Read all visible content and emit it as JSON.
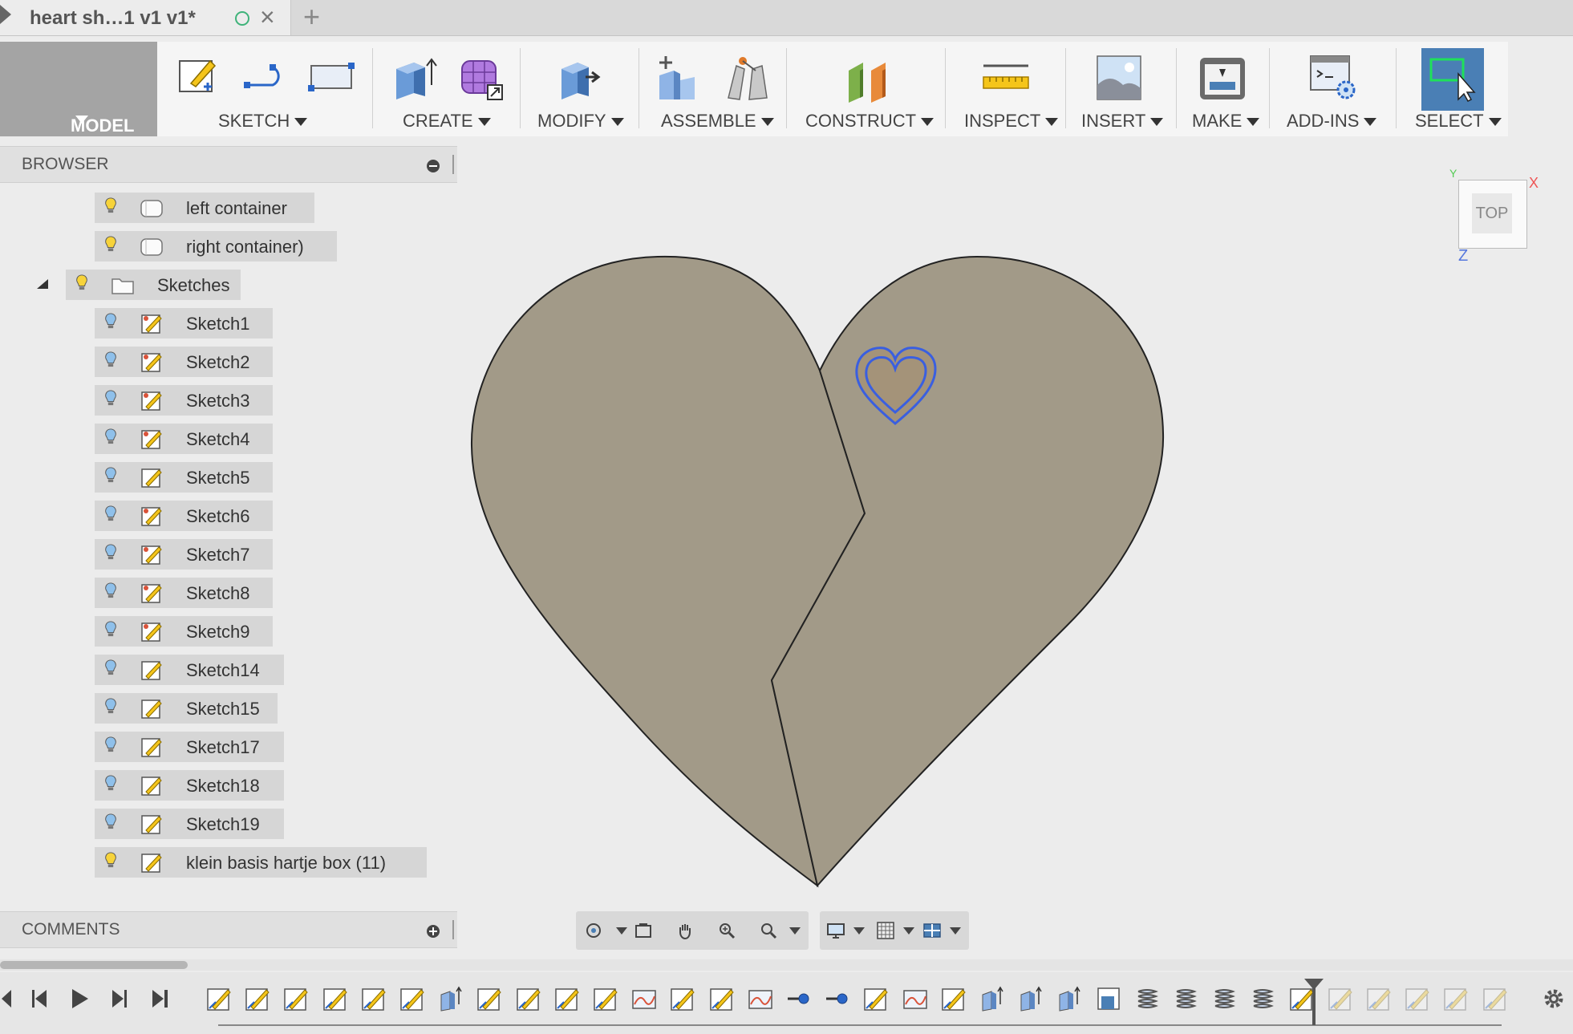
{
  "tab": {
    "title": "heart sh…1 v1 v1*",
    "close_icon": "×",
    "new_tab_icon": "+"
  },
  "toolbar": {
    "model_label": "MODEL",
    "groups": [
      {
        "label": "SKETCH"
      },
      {
        "label": "CREATE"
      },
      {
        "label": "MODIFY"
      },
      {
        "label": "ASSEMBLE"
      },
      {
        "label": "CONSTRUCT"
      },
      {
        "label": "INSPECT"
      },
      {
        "label": "INSERT"
      },
      {
        "label": "MAKE"
      },
      {
        "label": "ADD-INS"
      },
      {
        "label": "SELECT"
      }
    ]
  },
  "browser": {
    "title": "BROWSER",
    "items": [
      {
        "label": "left container",
        "icon": "body-icon"
      },
      {
        "label": "right container)",
        "icon": "body-icon"
      },
      {
        "label": "Sketches",
        "icon": "folder-icon"
      },
      {
        "label": "Sketch1",
        "icon": "sketch-icon"
      },
      {
        "label": "Sketch2",
        "icon": "sketch-icon"
      },
      {
        "label": "Sketch3",
        "icon": "sketch-icon"
      },
      {
        "label": "Sketch4",
        "icon": "sketch-icon"
      },
      {
        "label": "Sketch5",
        "icon": "sketch-icon"
      },
      {
        "label": "Sketch6",
        "icon": "sketch-icon"
      },
      {
        "label": "Sketch7",
        "icon": "sketch-icon"
      },
      {
        "label": "Sketch8",
        "icon": "sketch-icon"
      },
      {
        "label": "Sketch9",
        "icon": "sketch-icon"
      },
      {
        "label": "Sketch14",
        "icon": "sketch-icon"
      },
      {
        "label": "Sketch15",
        "icon": "sketch-icon"
      },
      {
        "label": "Sketch17",
        "icon": "sketch-icon"
      },
      {
        "label": "Sketch18",
        "icon": "sketch-icon"
      },
      {
        "label": "Sketch19",
        "icon": "sketch-icon"
      },
      {
        "label": "klein basis hartje box (11)",
        "icon": "sketch-icon"
      }
    ]
  },
  "comments": {
    "title": "COMMENTS"
  },
  "viewcube": {
    "face_label": "TOP",
    "axis_x": "X",
    "axis_y": "Y",
    "axis_z": "Z"
  },
  "colors": {
    "heart_fill": "#a29a88",
    "select_accent": "#4a7fb5",
    "inner_heart_outline": "#3a5fe0"
  }
}
